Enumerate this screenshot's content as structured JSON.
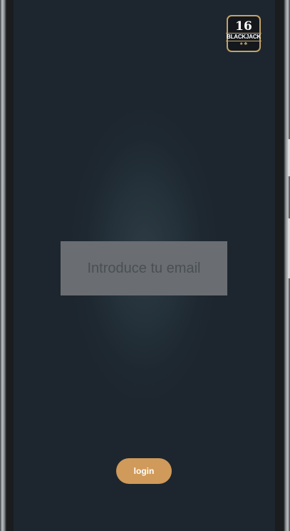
{
  "logo": {
    "number": "16",
    "text": "BLACKJACK",
    "chips": "♠ ♣"
  },
  "email": {
    "placeholder": "Introduce tu email",
    "value": ""
  },
  "login_button": {
    "label": "login"
  },
  "colors": {
    "background": "#1e2830",
    "input_background": "#6a6e72",
    "button": "#d09a5a",
    "logo_border": "#c2a26a"
  }
}
